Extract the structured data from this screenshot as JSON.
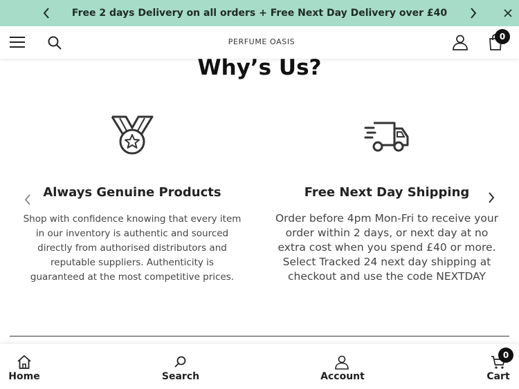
{
  "announcement": {
    "text": "Free 2 days Delivery on all orders + Free Next Day Delivery over £40",
    "prev_icon": "chevron-left-icon",
    "next_icon": "chevron-right-icon",
    "close_icon": "close-icon",
    "background": "#a7dcc9"
  },
  "header": {
    "logo": "PERFUME OASIS",
    "menu_icon": "hamburger-menu-icon",
    "search_icon": "search-icon",
    "account_icon": "user-icon",
    "cart_icon": "shopping-bag-icon",
    "cart_count": "0"
  },
  "section": {
    "title": "Why’s Us?",
    "features": [
      {
        "icon": "medal-icon",
        "title": "Always Genuine Products",
        "description": "Shop with confidence knowing that every item in our inventory is authentic and sourced directly from authorised distributors and reputable suppliers. Authenticity is guaranteed at the most competitive prices."
      },
      {
        "icon": "delivery-truck-icon",
        "title": "Free Next Day Shipping",
        "description": "Order before 4pm Mon-Fri to receive your order within 2 days, or next day at no extra cost when you spend £40 or more. Select Tracked 24 next day shipping at checkout and use the code NEXTDAY"
      }
    ]
  },
  "bottom_nav": {
    "items": [
      {
        "label": "Home",
        "icon": "home-icon"
      },
      {
        "label": "Search",
        "icon": "search-icon"
      },
      {
        "label": "Account",
        "icon": "user-icon"
      },
      {
        "label": "Cart",
        "icon": "cart-icon"
      }
    ],
    "cart_count": "0"
  }
}
